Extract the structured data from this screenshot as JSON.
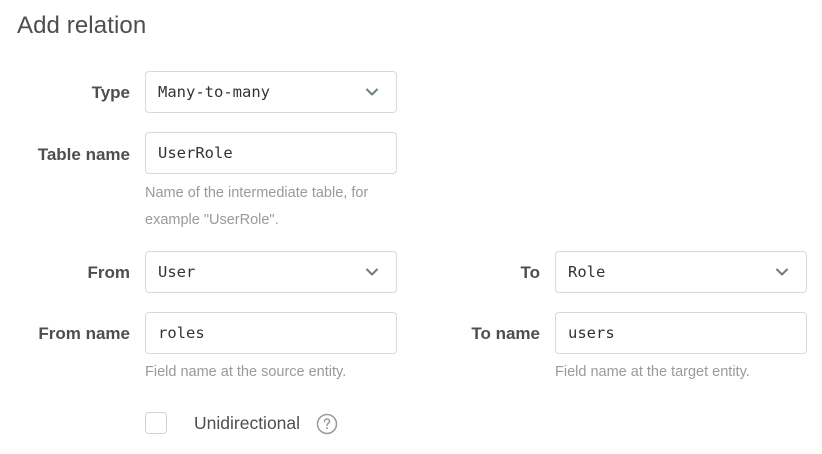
{
  "header": {
    "title": "Add relation"
  },
  "form": {
    "type": {
      "label": "Type",
      "value": "Many-to-many"
    },
    "table_name": {
      "label": "Table name",
      "value": "UserRole",
      "help_line1": "Name of the intermediate table, for",
      "help_line2": "example \"UserRole\"."
    },
    "from": {
      "label": "From",
      "value": "User"
    },
    "to": {
      "label": "To",
      "value": "Role"
    },
    "from_name": {
      "label": "From name",
      "value": "roles",
      "help": "Field name at the source entity."
    },
    "to_name": {
      "label": "To name",
      "value": "users",
      "help": "Field name at the target entity."
    },
    "unidirectional": {
      "label": "Unidirectional",
      "checked": false
    }
  },
  "icons": {
    "select_chevron": "chevron-down-icon",
    "help": "question-circle-icon"
  },
  "colors": {
    "text": "#4b4f52",
    "help_text": "#9a9a9a",
    "border": "#d9d9d9",
    "chevron": "#6d7f79"
  }
}
